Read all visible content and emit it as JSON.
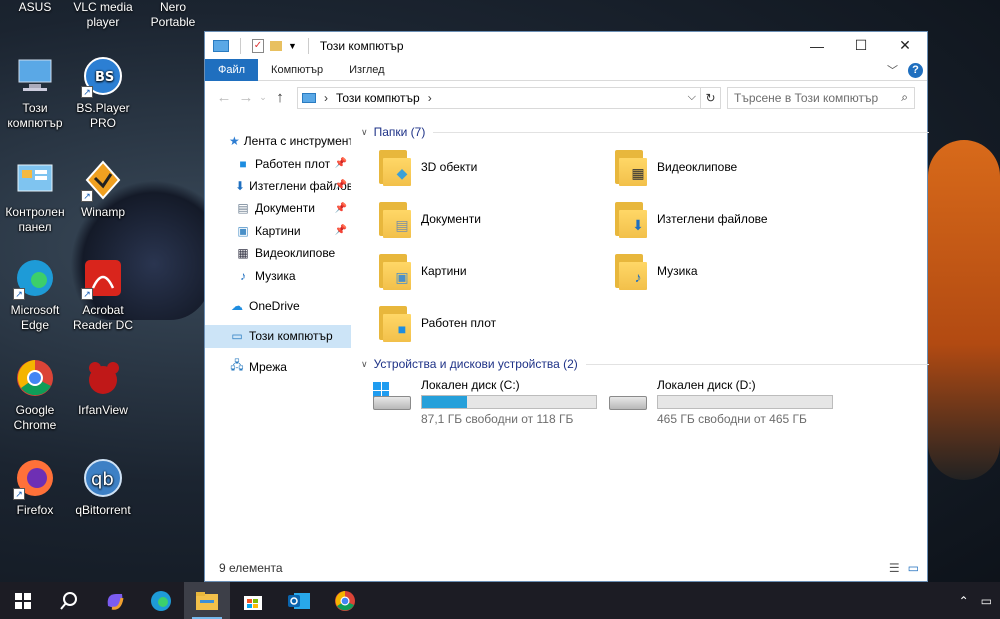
{
  "desktop": {
    "top_labels": [
      "ASUS",
      "VLC media player",
      "Nero Portable"
    ],
    "icons": [
      {
        "label": "Този компютър",
        "icon": "this-pc-icon"
      },
      {
        "label": "BS.Player PRO",
        "icon": "bsplayer-icon"
      },
      {
        "label": "Контролен панел",
        "icon": "control-panel-icon"
      },
      {
        "label": "Winamp",
        "icon": "winamp-icon"
      },
      {
        "label": "Microsoft Edge",
        "icon": "edge-icon"
      },
      {
        "label": "Acrobat Reader DC",
        "icon": "acrobat-icon"
      },
      {
        "label": "Google Chrome",
        "icon": "chrome-icon"
      },
      {
        "label": "IrfanView",
        "icon": "irfanview-icon"
      },
      {
        "label": "Firefox",
        "icon": "firefox-icon"
      },
      {
        "label": "qBittorrent",
        "icon": "qbittorrent-icon"
      }
    ]
  },
  "window": {
    "title": "Този компютър",
    "controls": {
      "minimize": "—",
      "maximize": "☐",
      "close": "✕"
    },
    "ribbon_tabs": [
      "Файл",
      "Компютър",
      "Изглед"
    ],
    "help": "?",
    "address": {
      "path": "Този компютър"
    },
    "search": {
      "placeholder": "Търсене в Този компютър"
    },
    "nav": {
      "quick_access": "Лента с инструменти",
      "items": [
        "Работен плот",
        "Изтеглени файлове",
        "Документи",
        "Картини",
        "Видеоклипове",
        "Музика"
      ],
      "onedrive": "OneDrive",
      "this_pc": "Този компютър",
      "network": "Мрежа"
    },
    "folders_header": "Папки (7)",
    "folders": [
      "3D обекти",
      "Видеоклипове",
      "Документи",
      "Изтеглени файлове",
      "Картини",
      "Музика",
      "Работен плот"
    ],
    "drives_header": "Устройства и дискови устройства (2)",
    "drives": [
      {
        "name": "Локален диск (C:)",
        "free": "87,1 ГБ свободни от 118 ГБ",
        "used_fraction": 0.26
      },
      {
        "name": "Локален диск (D:)",
        "free": "465 ГБ свободни от 465 ГБ",
        "used_fraction": 0.0
      }
    ],
    "status": "9 елемента"
  },
  "taskbar": {
    "items": [
      "start-icon",
      "search-icon",
      "copilot-icon",
      "edge-icon",
      "file-explorer-icon",
      "store-icon",
      "outlook-icon",
      "chrome-icon"
    ]
  },
  "colors": {
    "accent": "#1f6fbf",
    "selection": "#cce4f7",
    "drive_fill": "#26a0da",
    "group_header": "#1e3287"
  }
}
